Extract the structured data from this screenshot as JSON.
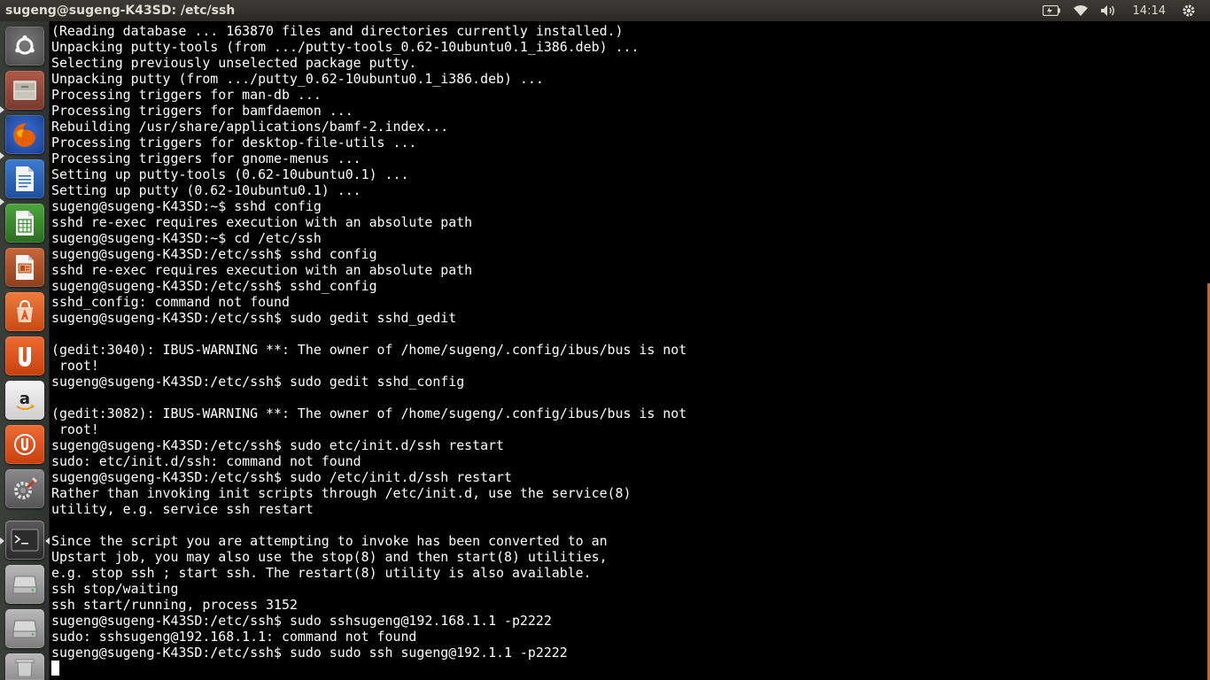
{
  "window": {
    "title": "sugeng@sugeng-K43SD: /etc/ssh"
  },
  "top_panel": {
    "clock": "14:14",
    "indicators": [
      "battery-icon",
      "wifi-icon",
      "volume-icon",
      "session-gear-icon"
    ]
  },
  "launcher": {
    "items": [
      {
        "name": "ubuntu-dash-icon",
        "color": "#5e5e5e"
      },
      {
        "name": "files-icon",
        "color": "#8b4a3c"
      },
      {
        "name": "firefox-icon",
        "color": "#e66000"
      },
      {
        "name": "libreoffice-writer-icon",
        "color": "#2a6ebb"
      },
      {
        "name": "libreoffice-calc-icon",
        "color": "#3c8c2f"
      },
      {
        "name": "libreoffice-impress-icon",
        "color": "#b84f1a"
      },
      {
        "name": "software-center-icon",
        "color": "#e95d24"
      },
      {
        "name": "ubuntu-one-icon",
        "color": "#dd4814"
      },
      {
        "name": "amazon-icon",
        "color": "#e8e8e8"
      },
      {
        "name": "ubuntu-one-music-icon",
        "color": "#dd4814"
      },
      {
        "name": "system-settings-icon",
        "color": "#7b7b7b"
      },
      {
        "name": "terminal-icon",
        "color": "#3b3b3b"
      },
      {
        "name": "drive-icon",
        "color": "#9c9c9c"
      },
      {
        "name": "drive-icon-2",
        "color": "#9c9c9c"
      },
      {
        "name": "trash-icon",
        "color": "#9c9c9c"
      }
    ]
  },
  "terminal": {
    "lines": [
      "(Reading database ... 163870 files and directories currently installed.)",
      "Unpacking putty-tools (from .../putty-tools_0.62-10ubuntu0.1_i386.deb) ...",
      "Selecting previously unselected package putty.",
      "Unpacking putty (from .../putty_0.62-10ubuntu0.1_i386.deb) ...",
      "Processing triggers for man-db ...",
      "Processing triggers for bamfdaemon ...",
      "Rebuilding /usr/share/applications/bamf-2.index...",
      "Processing triggers for desktop-file-utils ...",
      "Processing triggers for gnome-menus ...",
      "Setting up putty-tools (0.62-10ubuntu0.1) ...",
      "Setting up putty (0.62-10ubuntu0.1) ...",
      "sugeng@sugeng-K43SD:~$ sshd config",
      "sshd re-exec requires execution with an absolute path",
      "sugeng@sugeng-K43SD:~$ cd /etc/ssh",
      "sugeng@sugeng-K43SD:/etc/ssh$ sshd config",
      "sshd re-exec requires execution with an absolute path",
      "sugeng@sugeng-K43SD:/etc/ssh$ sshd_config",
      "sshd_config: command not found",
      "sugeng@sugeng-K43SD:/etc/ssh$ sudo gedit sshd_gedit",
      "",
      "(gedit:3040): IBUS-WARNING **: The owner of /home/sugeng/.config/ibus/bus is not",
      " root!",
      "sugeng@sugeng-K43SD:/etc/ssh$ sudo gedit sshd_config",
      "",
      "(gedit:3082): IBUS-WARNING **: The owner of /home/sugeng/.config/ibus/bus is not",
      " root!",
      "sugeng@sugeng-K43SD:/etc/ssh$ sudo etc/init.d/ssh restart",
      "sudo: etc/init.d/ssh: command not found",
      "sugeng@sugeng-K43SD:/etc/ssh$ sudo /etc/init.d/ssh restart",
      "Rather than invoking init scripts through /etc/init.d, use the service(8)",
      "utility, e.g. service ssh restart",
      "",
      "Since the script you are attempting to invoke has been converted to an",
      "Upstart job, you may also use the stop(8) and then start(8) utilities,",
      "e.g. stop ssh ; start ssh. The restart(8) utility is also available.",
      "ssh stop/waiting",
      "ssh start/running, process 3152",
      "sugeng@sugeng-K43SD:/etc/ssh$ sudo sshsugeng@192.168.1.1 -p2222",
      "sudo: sshsugeng@192.168.1.1: command not found",
      "sugeng@sugeng-K43SD:/etc/ssh$ sudo sudo ssh sugeng@192.1.1 -p2222"
    ]
  }
}
